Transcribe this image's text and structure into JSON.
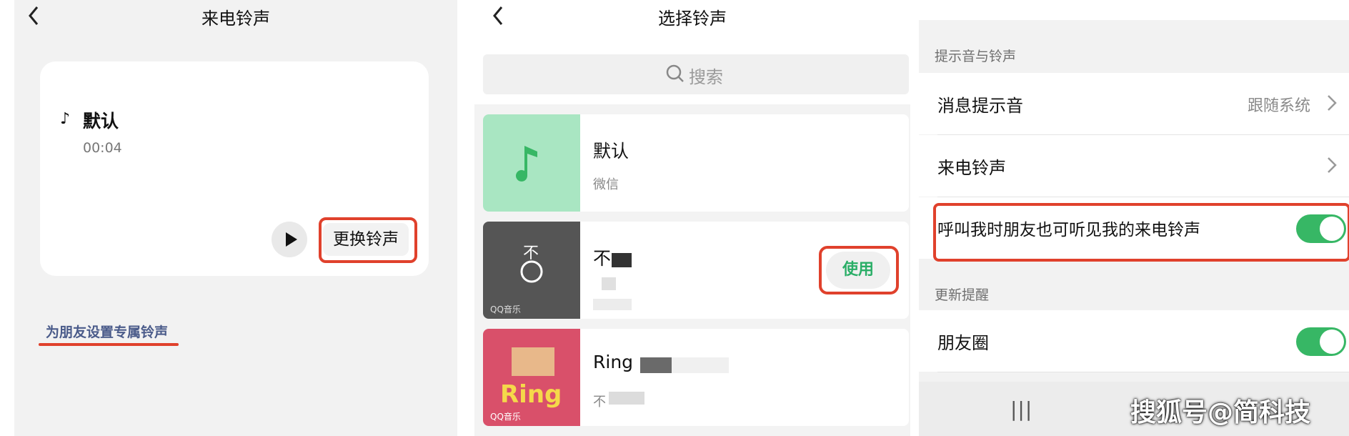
{
  "panel1": {
    "title": "来电铃声",
    "ringtone_name": "默认",
    "duration": "00:04",
    "change_button": "更换铃声",
    "friend_link": "为朋友设置专属铃声",
    "note_icon": "♪"
  },
  "panel2": {
    "title": "选择铃声",
    "search_placeholder": "搜索",
    "items": [
      {
        "title": "默认",
        "subtitle": "微信",
        "thumb_color": "#a9e6c2"
      },
      {
        "title": "不",
        "subtitle": "",
        "use_label": "使用",
        "thumb_label": "不",
        "thumb_source": "QQ音乐"
      },
      {
        "title": "Ring",
        "subtitle": "不",
        "thumb_label": "Ring",
        "thumb_source": "QQ音乐"
      }
    ]
  },
  "panel3": {
    "section1": "提示音与铃声",
    "rows": [
      {
        "label": "消息提示音",
        "value": "跟随系统"
      },
      {
        "label": "来电铃声"
      },
      {
        "label": "呼叫我时朋友也可听见我的来电铃声",
        "on": true
      }
    ],
    "section2": "更新提醒",
    "moments": {
      "label": "朋友圈",
      "on": true
    },
    "nav_icon": "|||"
  },
  "watermark": "搜狐号@简科技",
  "colors": {
    "accent_green": "#37b765",
    "highlight_red": "#e0412c",
    "link_blue": "#4a5b8a"
  }
}
